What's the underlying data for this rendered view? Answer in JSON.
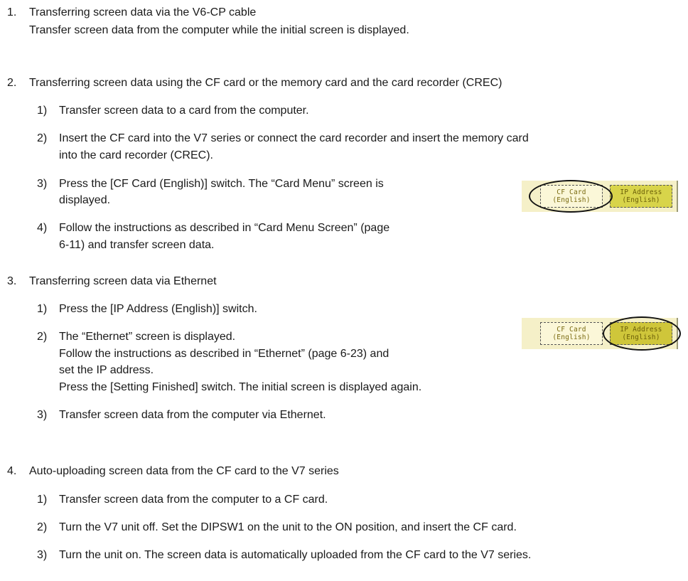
{
  "sections": [
    {
      "number": "1.",
      "heading": "Transferring screen data via the V6-CP cable",
      "lines": [
        "Transfer screen data from the computer while the initial screen is displayed."
      ]
    },
    {
      "number": "2.",
      "heading": "Transferring screen data using the CF card or the memory card and the card recorder (CREC)",
      "steps": [
        {
          "number": "1)",
          "lines": [
            "Transfer screen data to a card from the computer."
          ]
        },
        {
          "number": "2)",
          "lines": [
            "Insert the CF card into the V7 series or connect the card recorder and insert the memory card",
            "into the card recorder (CREC)."
          ]
        },
        {
          "number": "3)",
          "lines": [
            "Press the [CF Card (English)] switch.  The “Card Menu” screen is",
            "displayed."
          ]
        },
        {
          "number": "4)",
          "lines": [
            "Follow the instructions as described in “Card Menu Screen” (page",
            "6-11) and transfer screen data."
          ]
        }
      ]
    },
    {
      "number": "3.",
      "heading": "Transferring screen data via Ethernet",
      "steps": [
        {
          "number": "1)",
          "lines": [
            "Press the [IP Address (English)] switch."
          ]
        },
        {
          "number": "2)",
          "lines": [
            "The “Ethernet” screen is displayed.",
            "Follow the instructions as described in “Ethernet” (page 6-23) and",
            "set the IP address.",
            "Press the [Setting Finished] switch.  The initial screen is displayed again."
          ]
        },
        {
          "number": "3)",
          "lines": [
            "Transfer screen data from the computer via Ethernet."
          ]
        }
      ]
    },
    {
      "number": "4.",
      "heading": "Auto-uploading screen data from the CF card to the V7 series",
      "steps": [
        {
          "number": "1)",
          "lines": [
            "Transfer screen data from the computer to a CF card."
          ]
        },
        {
          "number": "2)",
          "lines": [
            "Turn the V7 unit off.  Set the DIPSW1 on the unit to the ON position, and insert the CF card."
          ]
        },
        {
          "number": "3)",
          "lines": [
            "Turn the unit on.  The screen data is automatically uploaded from the CF card to the V7 series."
          ]
        }
      ]
    }
  ],
  "figures": {
    "cf_card_switch": {
      "line1": "CF Card",
      "line2": "(English)"
    },
    "ip_address_switch": {
      "line1": "IP Address",
      "line2": "(English)"
    },
    "colors": {
      "panel": "#f5f0c8",
      "switch_plain": "#fbf7d8",
      "switch_lit": "#d8d44a",
      "ring": "#111111"
    }
  }
}
